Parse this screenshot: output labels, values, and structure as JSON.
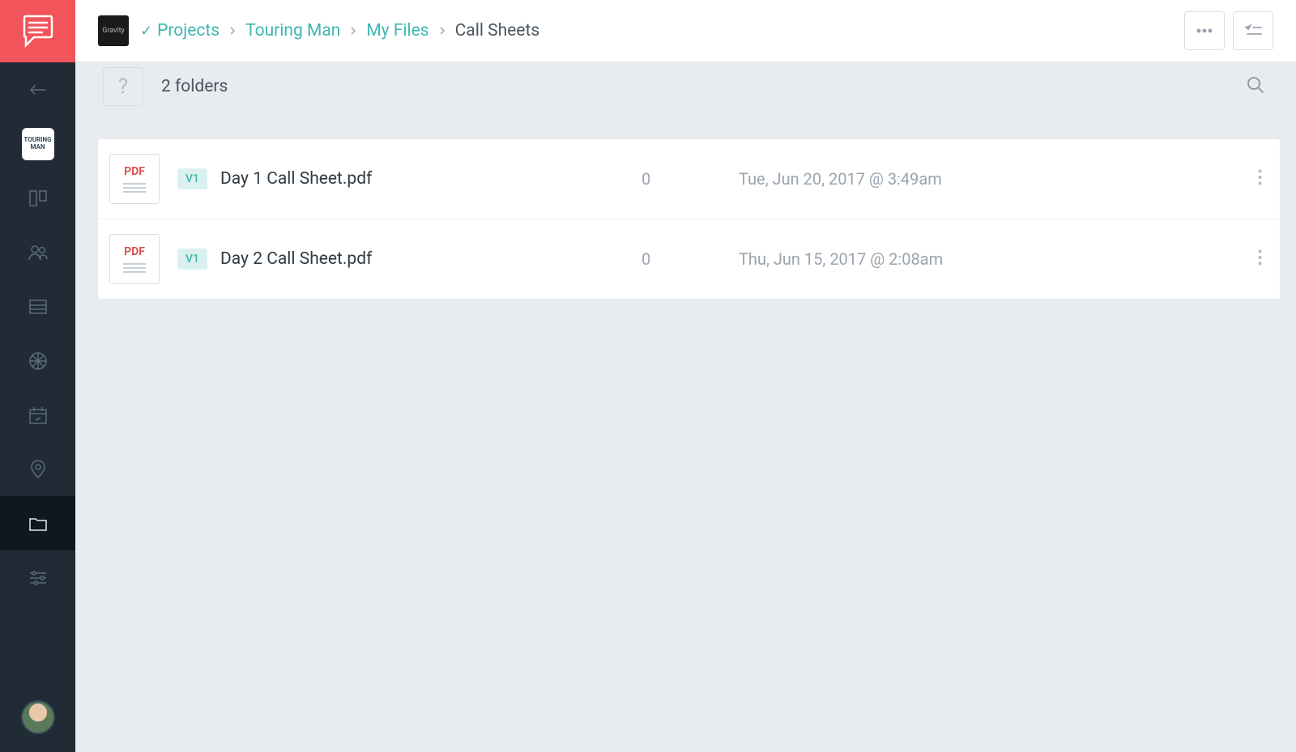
{
  "breadcrumb": {
    "items": [
      "Projects",
      "Touring Man",
      "My Files"
    ],
    "current": "Call Sheets"
  },
  "project_thumb_label": "Gravity",
  "subbar": {
    "count_label": "2 folders",
    "help_glyph": "?"
  },
  "files": [
    {
      "icon_label": "PDF",
      "version": "V1",
      "name": "Day 1 Call Sheet.pdf",
      "count": "0",
      "date": "Tue, Jun 20, 2017 @ 3:49am"
    },
    {
      "icon_label": "PDF",
      "version": "V1",
      "name": "Day 2 Call Sheet.pdf",
      "count": "0",
      "date": "Thu, Jun 15, 2017 @ 2:08am"
    }
  ],
  "sidebar": {
    "project_label": "TOURING\nMAN"
  }
}
